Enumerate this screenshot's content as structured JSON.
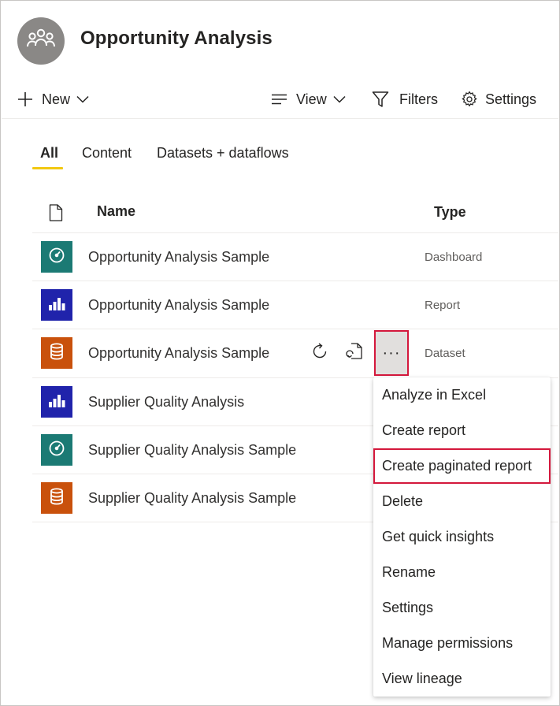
{
  "workspace": {
    "title": "Opportunity Analysis",
    "avatar_icon": "people-group-icon"
  },
  "toolbar": {
    "new_label": "New",
    "view_label": "View",
    "filters_label": "Filters",
    "settings_label": "Settings"
  },
  "tabs": [
    {
      "label": "All",
      "active": true
    },
    {
      "label": "Content",
      "active": false
    },
    {
      "label": "Datasets + dataflows",
      "active": false
    }
  ],
  "table": {
    "columns": {
      "name": "Name",
      "type": "Type"
    },
    "rows": [
      {
        "name": "Opportunity Analysis Sample",
        "type": "Dashboard",
        "icon": "dashboard-icon",
        "color": "#1b7a74"
      },
      {
        "name": "Opportunity Analysis Sample",
        "type": "Report",
        "icon": "report-icon",
        "color": "#2023ab"
      },
      {
        "name": "Opportunity Analysis Sample",
        "type": "Dataset",
        "icon": "dataset-icon",
        "color": "#c9510c"
      },
      {
        "name": "Supplier Quality Analysis",
        "type": "",
        "icon": "report-icon",
        "color": "#2023ab"
      },
      {
        "name": "Supplier Quality Analysis Sample",
        "type": "",
        "icon": "dashboard-icon",
        "color": "#1b7a74"
      },
      {
        "name": "Supplier Quality Analysis Sample",
        "type": "",
        "icon": "dataset-icon",
        "color": "#c9510c"
      }
    ]
  },
  "row_actions": {
    "more_label": "···"
  },
  "context_menu": {
    "items": [
      "Analyze in Excel",
      "Create report",
      "Create paginated report",
      "Delete",
      "Get quick insights",
      "Rename",
      "Settings",
      "Manage permissions",
      "View lineage"
    ],
    "highlighted_index": 2
  },
  "colors": {
    "accent_underline": "#f2c811",
    "highlight_border": "#d4183c"
  }
}
